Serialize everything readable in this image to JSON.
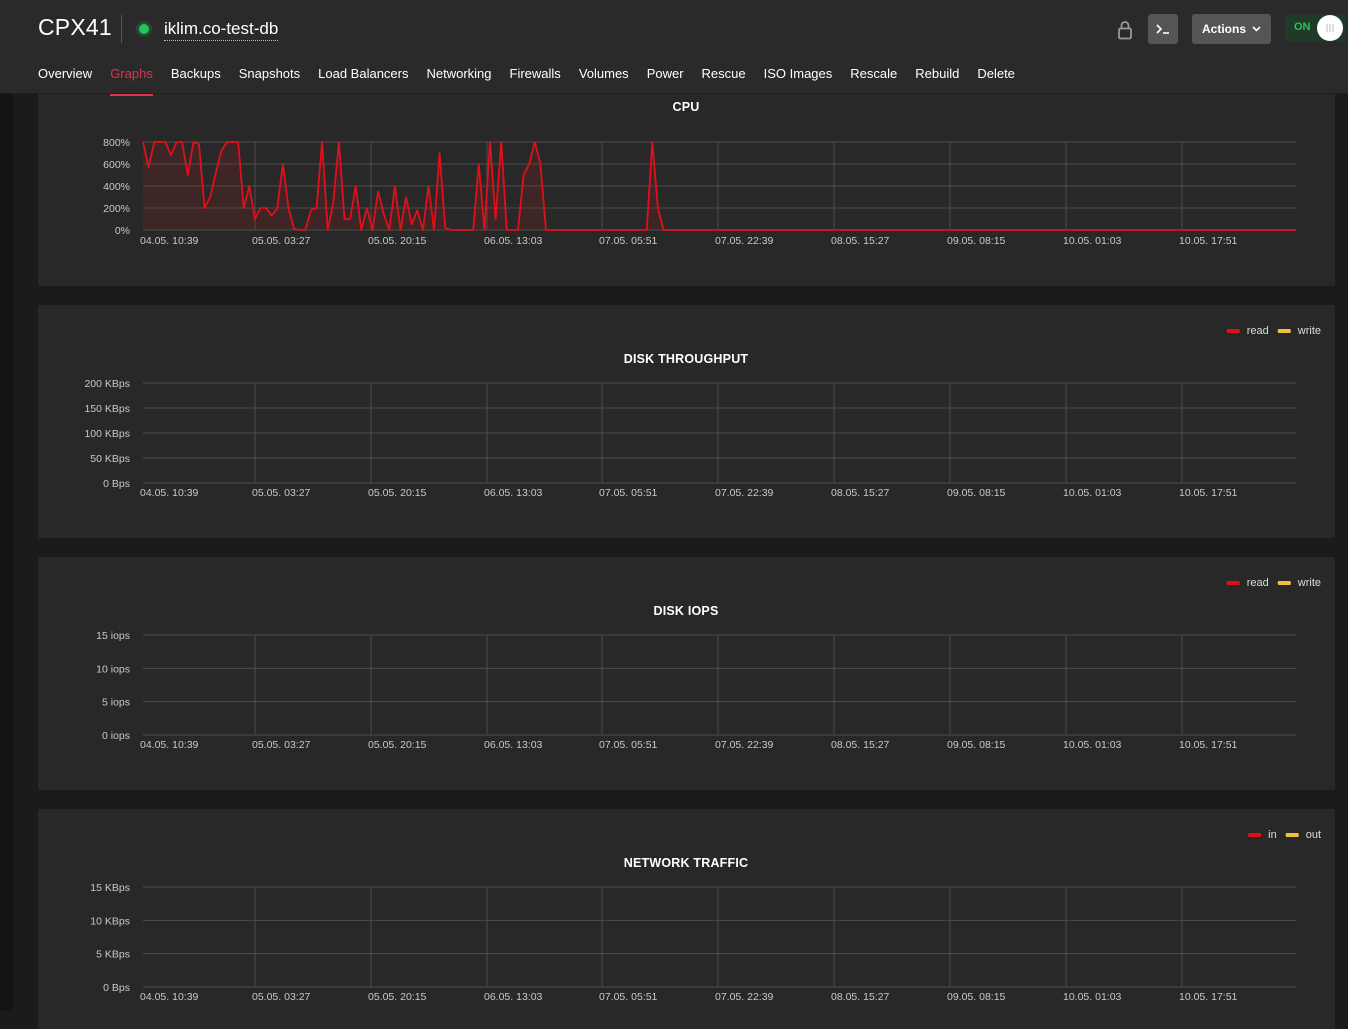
{
  "header": {
    "server_name": "CPX41",
    "hostname": "iklim.co-test-db",
    "status_color": "#22c55e",
    "actions_label": "Actions",
    "power_toggle_label": "ON",
    "icons": [
      "lock-icon",
      "console-icon",
      "chevron-down-icon",
      "toggle-knob"
    ]
  },
  "tabs": [
    {
      "label": "Overview"
    },
    {
      "label": "Graphs",
      "active": true
    },
    {
      "label": "Backups"
    },
    {
      "label": "Snapshots"
    },
    {
      "label": "Load Balancers"
    },
    {
      "label": "Networking"
    },
    {
      "label": "Firewalls"
    },
    {
      "label": "Volumes"
    },
    {
      "label": "Power"
    },
    {
      "label": "Rescue"
    },
    {
      "label": "ISO Images"
    },
    {
      "label": "Rescale"
    },
    {
      "label": "Rebuild"
    },
    {
      "label": "Delete"
    }
  ],
  "colors": {
    "accent": "#e0324b",
    "read": "#e0101a",
    "write": "#f0c040",
    "background": "#1b1b1b",
    "panel": "#282828"
  },
  "x_labels": [
    "04.05. 10:39",
    "05.05. 03:27",
    "05.05. 20:15",
    "06.05. 13:03",
    "07.05. 05:51",
    "07.05. 22:39",
    "08.05. 15:27",
    "09.05. 08:15",
    "10.05. 01:03",
    "10.05. 17:51"
  ],
  "chart_data": [
    {
      "type": "area",
      "title": "CPU",
      "y_ticks": [
        "800%",
        "600%",
        "400%",
        "200%",
        "0%"
      ],
      "ylim": [
        0,
        800
      ],
      "legend": [],
      "series": [
        {
          "color_key": "read",
          "values": [
            800,
            570,
            800,
            800,
            800,
            680,
            800,
            800,
            500,
            800,
            780,
            200,
            300,
            520,
            720,
            800,
            800,
            800,
            200,
            400,
            100,
            200,
            200,
            130,
            200,
            600,
            200,
            10,
            0,
            0,
            180,
            200,
            800,
            0,
            250,
            800,
            100,
            100,
            400,
            0,
            200,
            0,
            350,
            150,
            0,
            400,
            0,
            300,
            50,
            180,
            0,
            400,
            0,
            700,
            20,
            0,
            0,
            0,
            0,
            0,
            600,
            0,
            800,
            100,
            800,
            0,
            0,
            0,
            500,
            600,
            800,
            600,
            0,
            0,
            0,
            0,
            0,
            0,
            0,
            0,
            0,
            0,
            0,
            0,
            0,
            0,
            0,
            0,
            0,
            0,
            0,
            800,
            200,
            0,
            0,
            0,
            0,
            0,
            0,
            0,
            0,
            0,
            0,
            0,
            0,
            0,
            0,
            0,
            0,
            0,
            0,
            0,
            0,
            0,
            0,
            0,
            0,
            0,
            0,
            0,
            0,
            0,
            0,
            0,
            0,
            0,
            0,
            0,
            0,
            0,
            0,
            0,
            0,
            0,
            0,
            0,
            0,
            0,
            0,
            0,
            0,
            0,
            0,
            0,
            0,
            0,
            0,
            0,
            0,
            0,
            0,
            0,
            0,
            0,
            0,
            0,
            0,
            0,
            0,
            0,
            0,
            0,
            0,
            0,
            0,
            0,
            0,
            0,
            0,
            0,
            0,
            0,
            0,
            0,
            0,
            0,
            0,
            0,
            0,
            0,
            0,
            0,
            0,
            0,
            0,
            0,
            0,
            0,
            0,
            0,
            0,
            0,
            0,
            0,
            0,
            0,
            0,
            0,
            0,
            0,
            0,
            0,
            0,
            0,
            0,
            0,
            0
          ]
        },
        {
          "color_key": "write",
          "values": []
        }
      ]
    },
    {
      "type": "area",
      "title": "DISK THROUGHPUT",
      "y_ticks": [
        "200 KBps",
        "150 KBps",
        "100 KBps",
        "50 KBps",
        "0 Bps"
      ],
      "ylim": [
        0,
        200
      ],
      "legend": [
        "read",
        "write"
      ],
      "series": [
        {
          "name": "read",
          "color_key": "read",
          "values": []
        },
        {
          "name": "write",
          "color_key": "write",
          "values": []
        }
      ]
    },
    {
      "type": "area",
      "title": "DISK IOPS",
      "y_ticks": [
        "15 iops",
        "10 iops",
        "5 iops",
        "0 iops"
      ],
      "ylim": [
        0,
        15
      ],
      "legend": [
        "read",
        "write"
      ],
      "series": [
        {
          "name": "read",
          "color_key": "read",
          "values": []
        },
        {
          "name": "write",
          "color_key": "write",
          "values": []
        }
      ]
    },
    {
      "type": "area",
      "title": "NETWORK TRAFFIC",
      "y_ticks": [
        "15 KBps",
        "10 KBps",
        "5 KBps",
        "0 Bps"
      ],
      "ylim": [
        0,
        15
      ],
      "legend": [
        "in",
        "out"
      ],
      "series": [
        {
          "name": "in",
          "color_key": "read",
          "values": []
        },
        {
          "name": "out",
          "color_key": "write",
          "values": []
        }
      ]
    }
  ]
}
